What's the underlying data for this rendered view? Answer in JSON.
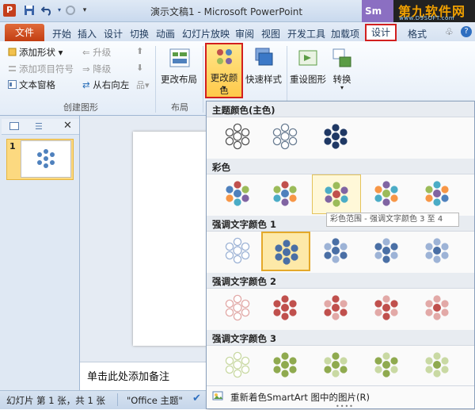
{
  "title_bar": {
    "app_icon": "P",
    "title": "演示文稿1 - Microsoft PowerPoint",
    "badge": "Sm",
    "watermark_main": "第九软件网",
    "watermark_url": "www.D9SOFT.com",
    "qat_icons": [
      "save-icon",
      "undo-icon",
      "redo-icon",
      "customize-qat-icon"
    ]
  },
  "tabs": {
    "file": "文件",
    "items": [
      "开始",
      "插入",
      "设计",
      "切换",
      "动画",
      "幻灯片放映",
      "审阅",
      "视图",
      "开发工具",
      "加载项"
    ],
    "design_context": "设计",
    "format_context": "格式",
    "help": "?",
    "minimize": "♧"
  },
  "ribbon": {
    "create_graphic": {
      "add_shape": "添加形状",
      "add_bullet": "添加项目符号",
      "text_pane": "文本窗格",
      "promote": "升级",
      "demote": "降级",
      "right_to_left": "从右向左",
      "label": "创建图形"
    },
    "layouts": {
      "change_layout": "更改布局",
      "label": "布局"
    },
    "change_colors": "更改颜色",
    "quick_styles": "快速样式",
    "reset_graphic": "重设图形",
    "convert": "转换"
  },
  "slides_panel": {
    "slide_number": "1"
  },
  "notes": {
    "placeholder": "单击此处添加备注"
  },
  "status_bar": {
    "slide_info": "幻灯片 第 1 张，共 1 张",
    "theme": "\"Office 主题\""
  },
  "gallery": {
    "sections": [
      {
        "title": "主题颜色(主色)"
      },
      {
        "title": "彩色"
      },
      {
        "title": "强调文字颜色 1"
      },
      {
        "title": "强调文字颜色 2"
      },
      {
        "title": "强调文字颜色 3"
      }
    ],
    "tooltip": "彩色范围 - 强调文字颜色 3 至 4",
    "footer": "重新着色SmartArt 图中的图片(R)",
    "colors": {
      "theme_outline": "#555555",
      "theme_dark": "#1f3864",
      "accent1": "#4a6fa5",
      "accent1_light": "#9db3d6",
      "accent2": "#c0504d",
      "accent2_light": "#e2a9a7",
      "accent3": "#8faa4f",
      "accent3_light": "#c9d9a3",
      "colorful_palette": [
        "#4f81bd",
        "#c0504d",
        "#9bbb59",
        "#8064a2",
        "#4bacc6",
        "#f79646"
      ]
    }
  }
}
